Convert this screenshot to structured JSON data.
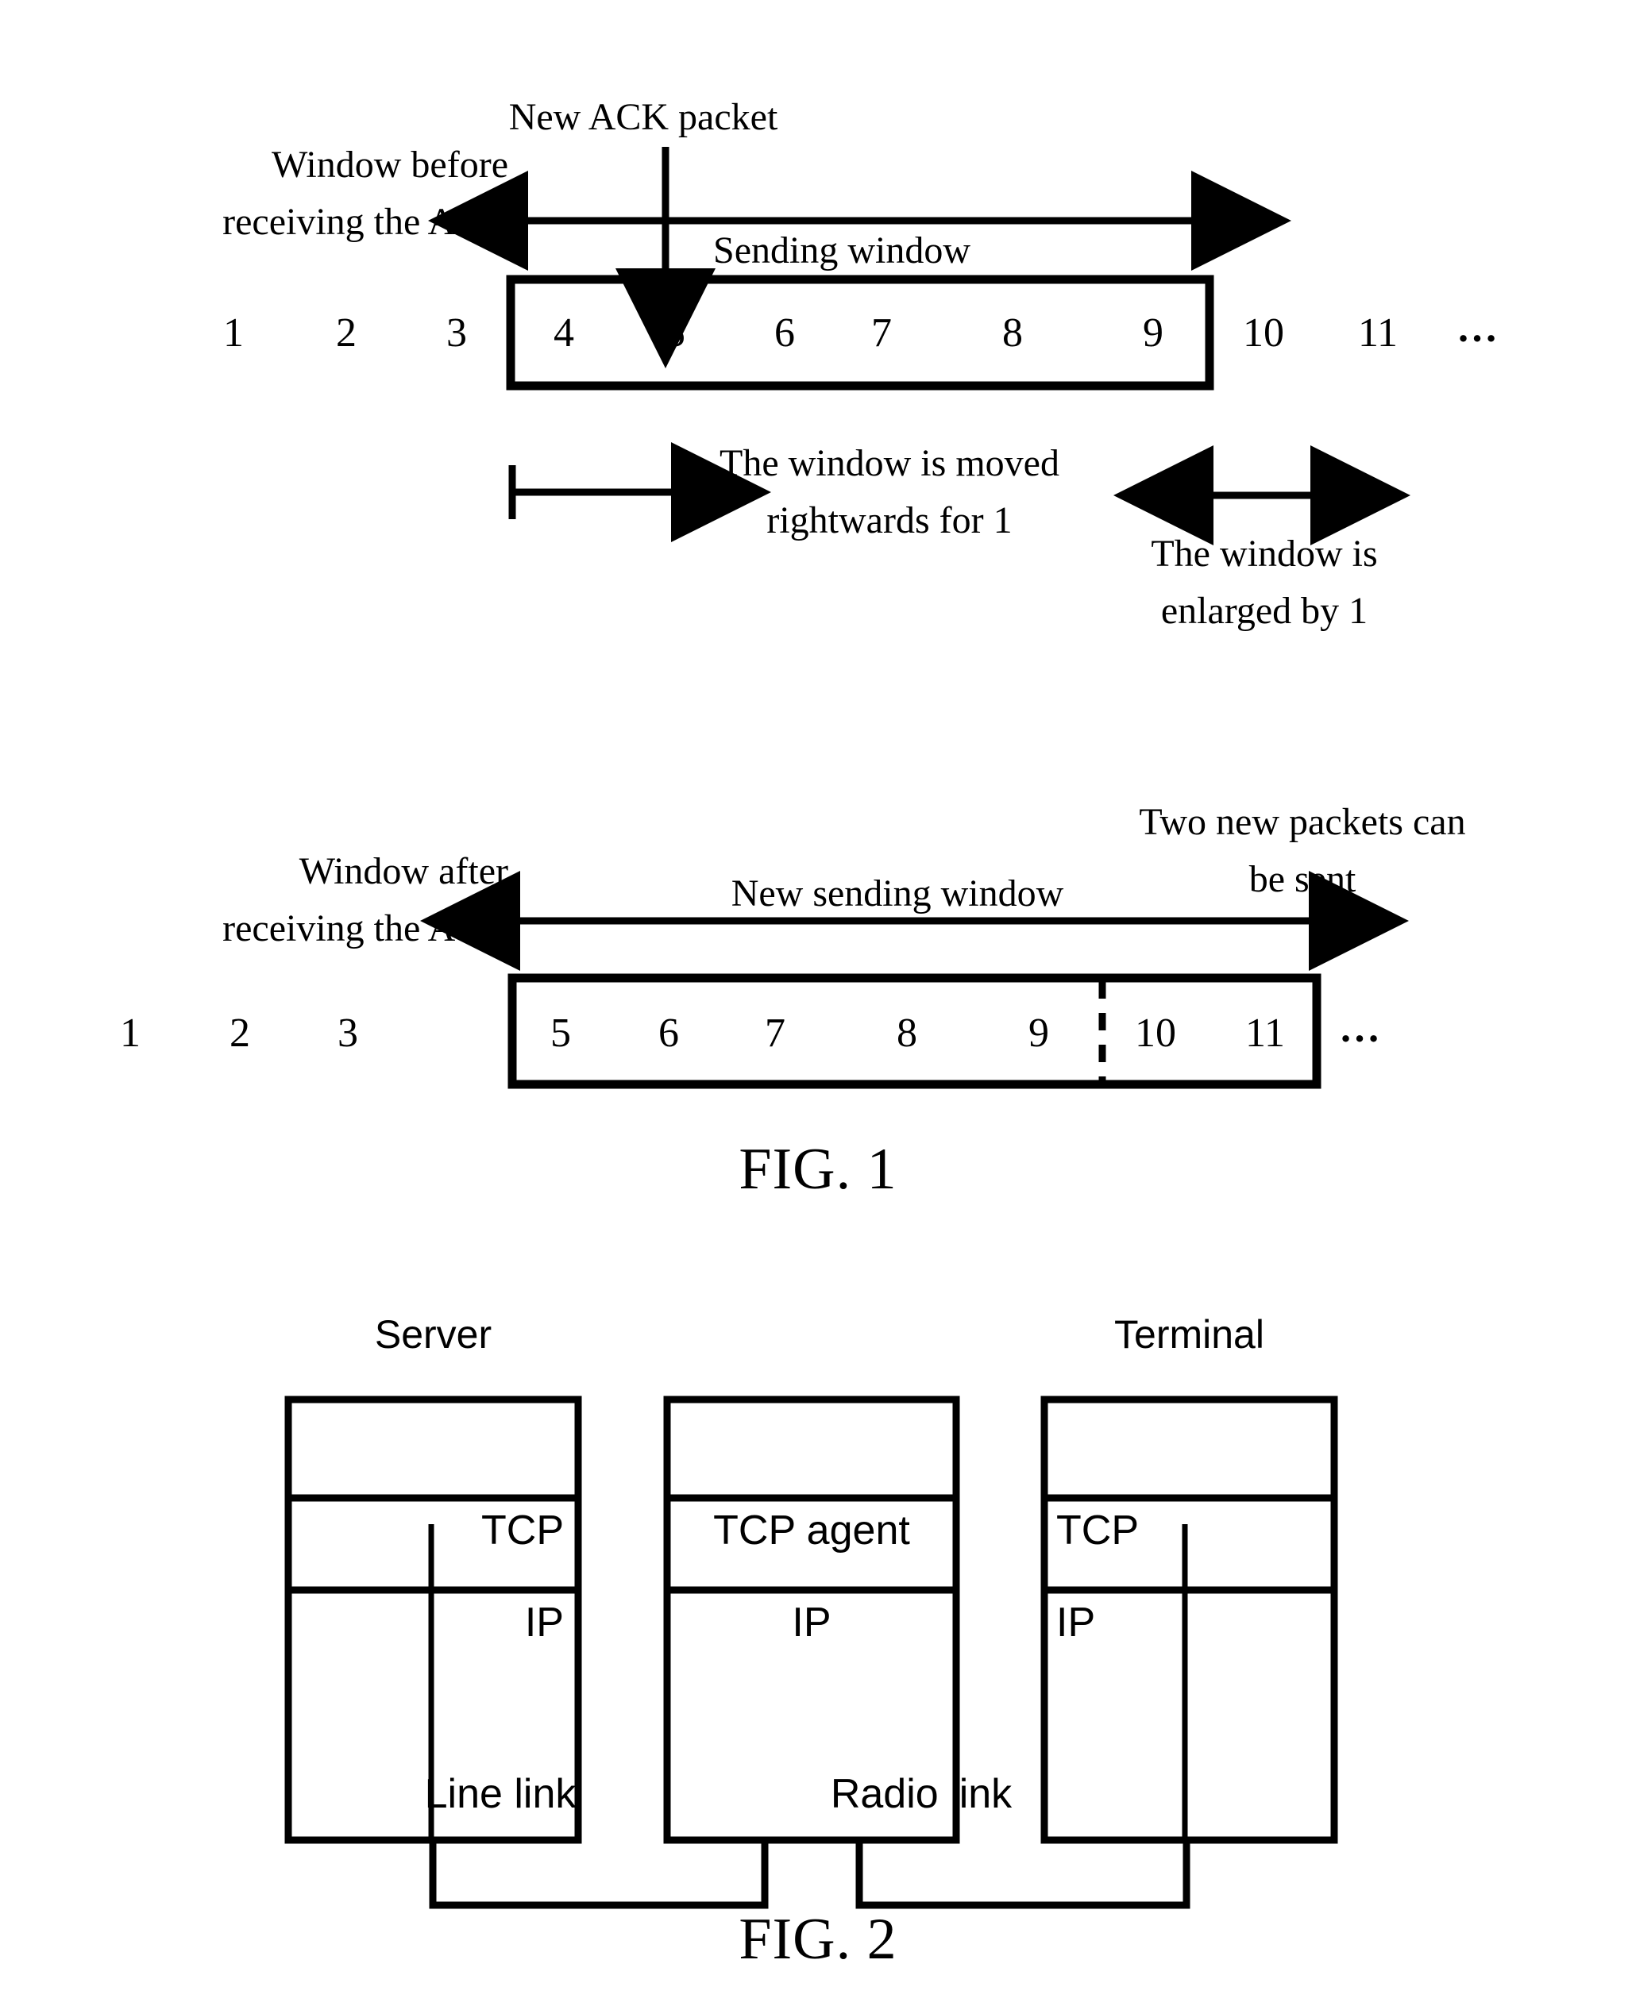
{
  "document": {
    "kind": "patent-drawing-sheet",
    "figures": [
      "FIG. 1",
      "FIG. 2"
    ]
  },
  "fig1": {
    "caption": "FIG. 1",
    "top_panel": {
      "new_ack_label": "New ACK packet",
      "window_before_label_line1": "Window before",
      "window_before_label_line2": "receiving the ACK",
      "sending_window_label": "Sending window",
      "outside_numbers_left": [
        "1",
        "2",
        "3"
      ],
      "window_numbers": [
        "4",
        "5",
        "6",
        "7",
        "8",
        "9"
      ],
      "outside_numbers_right": [
        "10",
        "11"
      ],
      "ellipsis": "…",
      "moved_note_line1": "The window is moved",
      "moved_note_line2": "rightwards for 1",
      "enlarged_note_line1": "The window is",
      "enlarged_note_line2": "enlarged by 1"
    },
    "bottom_panel": {
      "window_after_label_line1": "Window after",
      "window_after_label_line2": "receiving the ACK",
      "new_sending_window_label": "New sending window",
      "two_new_packets_line1": "Two new packets can",
      "two_new_packets_line2": "be sent",
      "outside_numbers_left": [
        "1",
        "2",
        "3"
      ],
      "window_numbers_existing": [
        "5",
        "6",
        "7",
        "8",
        "9"
      ],
      "window_numbers_new": [
        "10",
        "11"
      ],
      "ellipsis": "…"
    }
  },
  "fig2": {
    "caption": "FIG. 2",
    "nodes": [
      {
        "title": "Server",
        "rows": [
          "",
          "TCP",
          "IP"
        ],
        "row_align": [
          "center",
          "right",
          "right"
        ]
      },
      {
        "title": "",
        "rows": [
          "",
          "TCP agent",
          "IP"
        ],
        "row_align": [
          "center",
          "center",
          "center"
        ]
      },
      {
        "title": "Terminal",
        "rows": [
          "",
          "TCP",
          "IP"
        ],
        "row_align": [
          "center",
          "left",
          "left"
        ]
      }
    ],
    "links": [
      {
        "label": "Line link"
      },
      {
        "label": "Radio link"
      }
    ]
  },
  "colors": {
    "ink": "#000000",
    "paper": "#ffffff"
  }
}
